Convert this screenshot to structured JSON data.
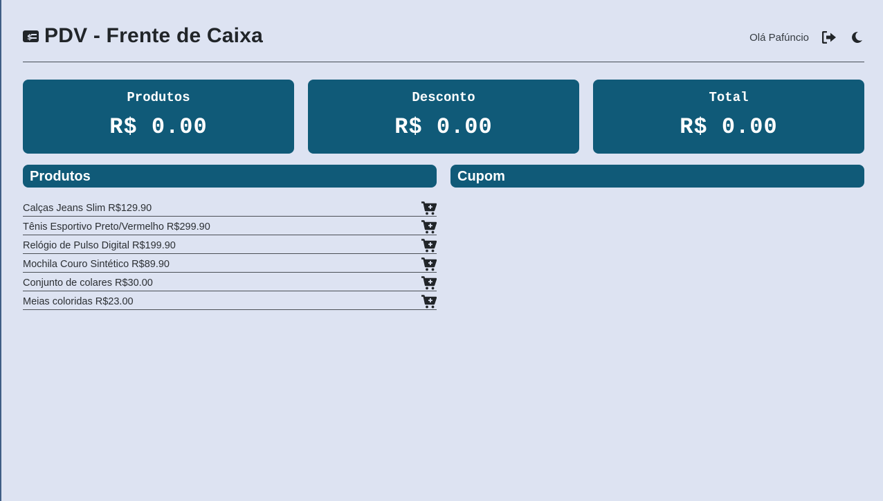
{
  "header": {
    "title": "PDV - Frente de Caixa",
    "title_icon": "money-bill-icon",
    "greeting": "Olá Pafúncio",
    "logout_icon": "sign-out-icon",
    "theme_icon": "moon-icon"
  },
  "summary": {
    "products": {
      "label": "Produtos",
      "value": "R$ 0.00"
    },
    "discount": {
      "label": "Desconto",
      "value": "R$ 0.00"
    },
    "total": {
      "label": "Total",
      "value": "R$ 0.00"
    }
  },
  "products_panel": {
    "title": "Produtos",
    "add_icon": "cart-plus-icon",
    "items": [
      {
        "text": "Calças Jeans Slim R$129.90"
      },
      {
        "text": "Tênis Esportivo Preto/Vermelho R$299.90"
      },
      {
        "text": "Relógio de Pulso Digital R$199.90"
      },
      {
        "text": "Mochila Couro Sintético R$89.90"
      },
      {
        "text": "Conjunto de colares R$30.00"
      },
      {
        "text": "Meias coloridas R$23.00"
      }
    ]
  },
  "coupon_panel": {
    "title": "Cupom"
  },
  "colors": {
    "background": "#dde3f2",
    "accent": "#105a78",
    "text": "#212529"
  }
}
